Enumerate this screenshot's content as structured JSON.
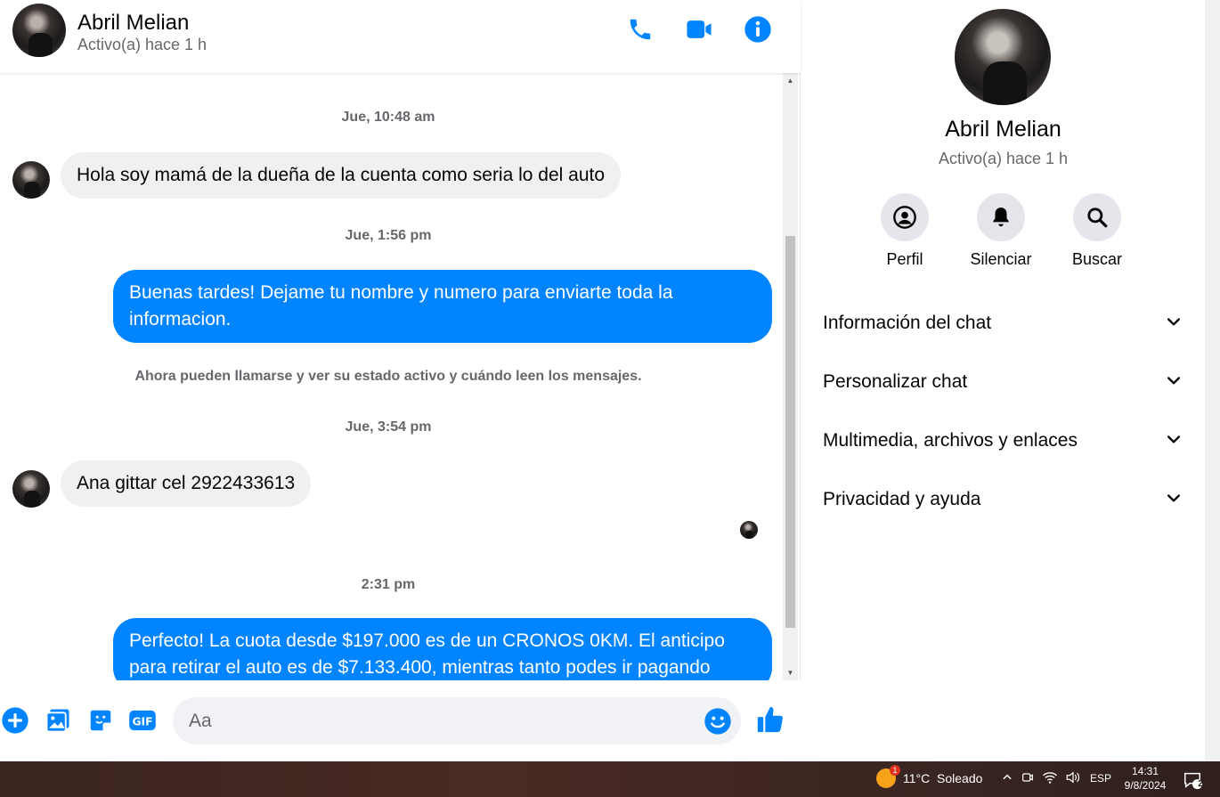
{
  "contact": {
    "name": "Abril Melian",
    "status": "Activo(a) hace 1 h"
  },
  "header_icons": [
    "phone-icon",
    "video-icon",
    "info-icon"
  ],
  "messages": {
    "ts1": "Jue, 10:48 am",
    "msg1": "Hola soy mamá de la dueña de la cuenta como seria lo del auto",
    "ts2": "Jue, 1:56 pm",
    "msg2": "Buenas tardes! Dejame tu nombre y numero para enviarte toda la informacion.",
    "system": "Ahora pueden llamarse y ver su estado activo y cuándo leen los mensajes.",
    "ts3": "Jue, 3:54 pm",
    "msg3": "Ana gittar cel 2922433613",
    "ts4": "2:31 pm",
    "msg4": "Perfecto! La cuota desde $197.000 es de un CRONOS 0KM. El anticipo para retirar el auto es de $7.133.400, mientras tanto podes ir pagando"
  },
  "composer": {
    "placeholder": "Aa",
    "value": ""
  },
  "panel": {
    "actions": [
      {
        "label": "Perfil",
        "icon": "profile-icon"
      },
      {
        "label": "Silenciar",
        "icon": "bell-icon"
      },
      {
        "label": "Buscar",
        "icon": "search-icon"
      }
    ],
    "sections": [
      "Información del chat",
      "Personalizar chat",
      "Multimedia, archivos y enlaces",
      "Privacidad y ayuda"
    ]
  },
  "taskbar": {
    "weather": "11°C  Soleado",
    "weather_badge": "1",
    "lang": "ESP",
    "time": "14:31",
    "date": "9/8/2024",
    "notif_count": "2"
  },
  "colors": {
    "accent": "#0084ff",
    "incoming_bubble": "#f0f0f0",
    "secondary_text": "#65676b"
  }
}
